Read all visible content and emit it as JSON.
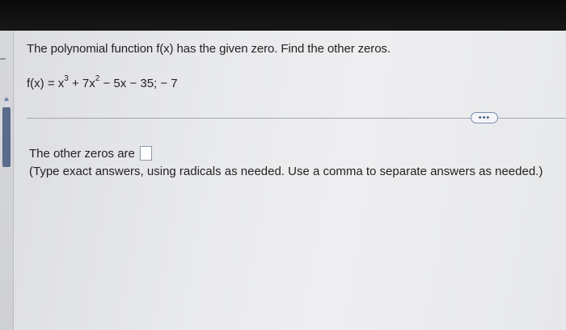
{
  "question": {
    "prompt": "The polynomial function f(x) has the given zero. Find the other zeros.",
    "function_lhs": "f(x) = x",
    "exp1": "3",
    "term2": " + 7x",
    "exp2": "2",
    "rest": " − 5x − 35;  − 7"
  },
  "toolbar": {
    "more_label": "•••"
  },
  "answer": {
    "label": "The other zeros are",
    "value": "",
    "instructions": "(Type exact answers, using radicals as needed. Use a comma to separate answers as needed.)"
  }
}
